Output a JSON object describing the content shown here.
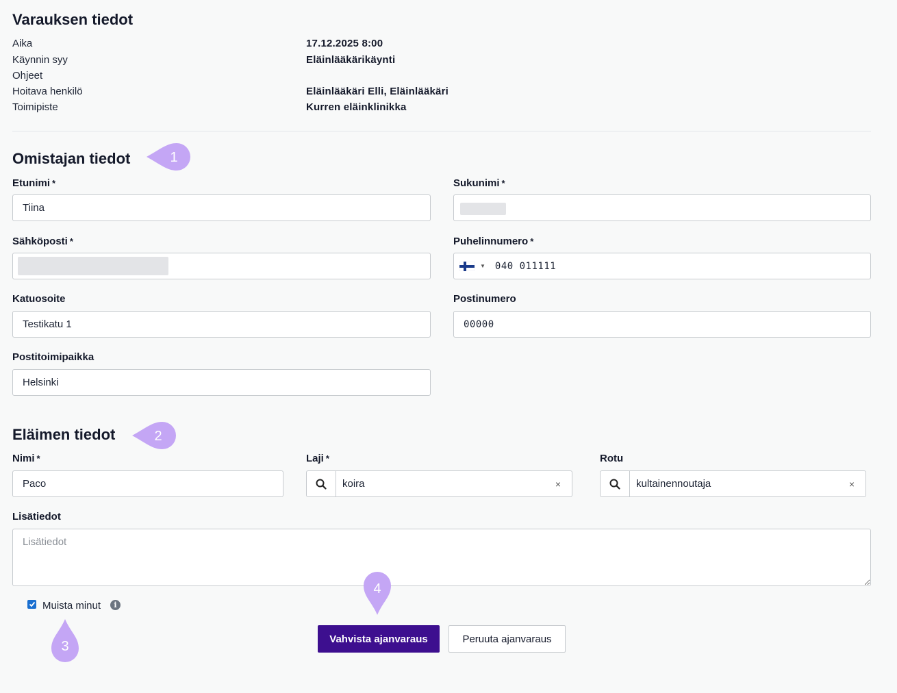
{
  "booking": {
    "title": "Varauksen tiedot",
    "rows": [
      {
        "label": "Aika",
        "value": "17.12.2025 8:00"
      },
      {
        "label": "Käynnin syy",
        "value": "Eläinlääkärikäynti"
      },
      {
        "label": "Ohjeet",
        "value": ""
      },
      {
        "label": "Hoitava henkilö",
        "value": "Eläinlääkäri Elli, Eläinlääkäri"
      },
      {
        "label": "Toimipiste",
        "value": "Kurren eläinklinikka"
      }
    ]
  },
  "owner": {
    "title": "Omistajan tiedot",
    "required_mark": "*",
    "first_name": {
      "label": "Etunimi",
      "value": "Tiina"
    },
    "last_name": {
      "label": "Sukunimi",
      "value": ""
    },
    "email": {
      "label": "Sähköposti",
      "value": ""
    },
    "phone": {
      "label": "Puhelinnumero",
      "value": "040 011111"
    },
    "street": {
      "label": "Katuosoite",
      "value": "Testikatu 1"
    },
    "postal_code": {
      "label": "Postinumero",
      "value": "00000"
    },
    "city": {
      "label": "Postitoimipaikka",
      "value": "Helsinki"
    }
  },
  "animal": {
    "title": "Eläimen tiedot",
    "name": {
      "label": "Nimi",
      "value": "Paco"
    },
    "species": {
      "label": "Laji",
      "value": "koira",
      "clear": "×"
    },
    "breed": {
      "label": "Rotu",
      "value": "kultainennoutaja",
      "clear": "×"
    },
    "notes": {
      "label": "Lisätiedot",
      "placeholder": "Lisätiedot"
    }
  },
  "remember_me": {
    "label": "Muista minut",
    "checked": true
  },
  "actions": {
    "confirm": "Vahvista ajanvaraus",
    "cancel": "Peruuta ajanvaraus"
  },
  "markers": [
    "1",
    "2",
    "3",
    "4"
  ],
  "colors": {
    "primary": "#3d0f8f",
    "marker": "#c4a6f5",
    "checkbox": "#1a6fd0"
  }
}
